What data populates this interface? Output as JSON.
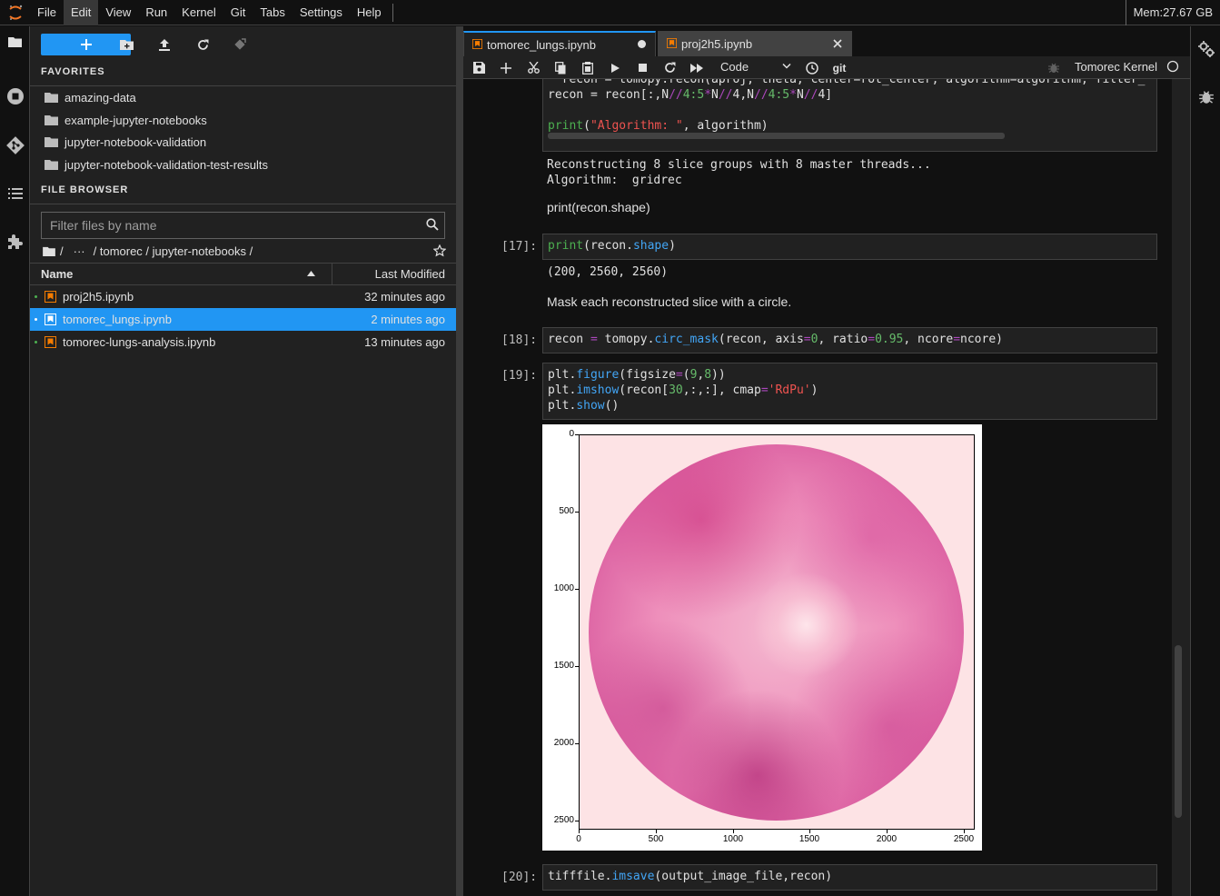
{
  "menu": {
    "items": [
      "File",
      "Edit",
      "View",
      "Run",
      "Kernel",
      "Git",
      "Tabs",
      "Settings",
      "Help"
    ],
    "active": "Edit",
    "memory": "Mem:27.67 GB"
  },
  "left_sidebar": {
    "icons": [
      "folder-icon",
      "running-icon",
      "git-icon",
      "toc-icon",
      "extension-icon"
    ]
  },
  "file_browser": {
    "favorites_title": "FAVORITES",
    "favorites": [
      "amazing-data",
      "example-jupyter-notebooks",
      "jupyter-notebook-validation",
      "jupyter-notebook-validation-test-results"
    ],
    "title": "FILE BROWSER",
    "filter_placeholder": "Filter files by name",
    "breadcrumb": {
      "root": "/",
      "ellipsis": "···",
      "path": "/ tomorec / jupyter-notebooks /"
    },
    "columns": {
      "name": "Name",
      "modified": "Last Modified"
    },
    "files": [
      {
        "name": "proj2h5.ipynb",
        "modified": "32 minutes ago",
        "selected": false
      },
      {
        "name": "tomorec_lungs.ipynb",
        "modified": "2 minutes ago",
        "selected": true
      },
      {
        "name": "tomorec-lungs-analysis.ipynb",
        "modified": "13 minutes ago",
        "selected": false
      }
    ]
  },
  "tabs": [
    {
      "label": "tomorec_lungs.ipynb",
      "current": true,
      "modified": true
    },
    {
      "label": "proj2h5.ipynb",
      "current": false,
      "modified": false
    }
  ],
  "notebook_toolbar": {
    "cell_type": "Code",
    "git_label": "git",
    "kernel": "Tomorec Kernel"
  },
  "cells": {
    "partial": {
      "line0": "  recon = tomopy.recon(aproj, theta, center=rot_center, algorithm=algorithm, filter_",
      "line1_a": "recon = recon[:,N",
      "line1_op1": "//",
      "line1_b": "4:5",
      "line1_op2": "*",
      "line1_c": "N",
      "line1_op3": "//",
      "line1_d": "4,N",
      "line1_op4": "//",
      "line1_e": "4:5",
      "line1_op5": "*",
      "line1_f": "N",
      "line1_op6": "//",
      "line1_g": "4]",
      "print_kw": "print",
      "print_str": "\"Algorithm: \"",
      "print_rest": ", algorithm)"
    },
    "partial_output": [
      "Reconstructing 8 slice groups with 8 master threads...",
      "Algorithm:  gridrec"
    ],
    "md1": "print(recon.shape)",
    "c17": {
      "prompt": "[17]:",
      "kw": "print",
      "a": "(recon.",
      "attr": "shape",
      "b": ")",
      "output": "(200, 2560, 2560)"
    },
    "md2": "Mask each reconstructed slice with a circle.",
    "c18": {
      "prompt": "[18]:",
      "a": "recon ",
      "eq1": "=",
      "b": " tomopy.",
      "fn": "circ_mask",
      "c": "(recon, axis",
      "eq2": "=",
      "n1": "0",
      "d": ", ratio",
      "eq3": "=",
      "n2": "0.95",
      "e": ", ncore",
      "eq4": "=",
      "f": "ncore)"
    },
    "c19": {
      "prompt": "[19]:",
      "l1_a": "plt.",
      "l1_fn": "figure",
      "l1_b": "(figsize",
      "l1_eq": "=",
      "l1_c": "(",
      "l1_n1": "9",
      "l1_d": ",",
      "l1_n2": "8",
      "l1_e": "))",
      "l2_a": "plt.",
      "l2_fn": "imshow",
      "l2_b": "(recon[",
      "l2_n": "30",
      "l2_c": ",:,:], cmap",
      "l2_eq": "=",
      "l2_str": "'RdPu'",
      "l2_d": ")",
      "l3_a": "plt.",
      "l3_fn": "show",
      "l3_b": "()"
    },
    "c20": {
      "prompt": "[20]:",
      "a": "tifffile.",
      "fn": "imsave",
      "b": "(output_image_file,recon)"
    }
  },
  "plot": {
    "y_ticks": [
      "0",
      "500",
      "1000",
      "1500",
      "2000",
      "2500"
    ],
    "x_ticks": [
      "0",
      "500",
      "1000",
      "1500",
      "2000",
      "2500"
    ],
    "colormap": "RdPu"
  },
  "colors": {
    "accent": "#2196f3",
    "notebook_icon": "#f57c00",
    "background": "#111111",
    "panel": "#212121"
  }
}
